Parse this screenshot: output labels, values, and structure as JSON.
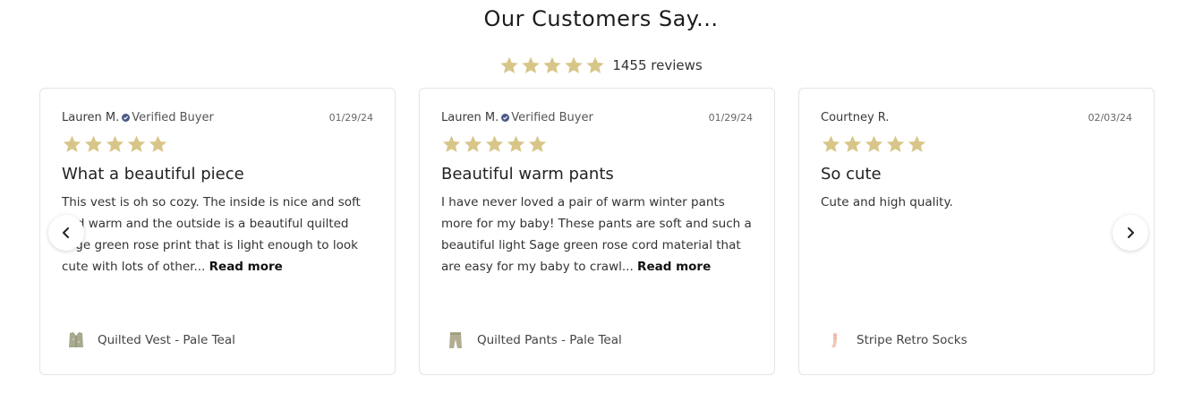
{
  "section_title": "Our Customers Say...",
  "summary": {
    "rating": 5,
    "count_text": "1455 reviews"
  },
  "colors": {
    "star": "#d8c689",
    "verified": "#4a5a87"
  },
  "reviews": [
    {
      "author": "Lauren M.",
      "verified": "Verified Buyer",
      "date": "01/29/24",
      "rating": 5,
      "title": "What a beautiful piece",
      "body": "This vest is oh so cozy. The inside is nice and soft and warm and the outside is a beautiful quilted sage green rose print that is light enough to look cute with lots of other...",
      "read_more": "Read more",
      "product": "Quilted Vest - Pale Teal",
      "product_icon": "vest-thumbnail-icon"
    },
    {
      "author": "Lauren M.",
      "verified": "Verified Buyer",
      "date": "01/29/24",
      "rating": 5,
      "title": "Beautiful warm pants",
      "body": "I have never loved a pair of warm winter pants more for my baby! These pants are soft and such a beautiful light Sage green rose cord material that are easy for my baby to crawl...",
      "read_more": "Read more",
      "product": "Quilted Pants - Pale Teal",
      "product_icon": "pants-thumbnail-icon"
    },
    {
      "author": "Courtney R.",
      "verified": "",
      "date": "02/03/24",
      "rating": 5,
      "title": "So cute",
      "body": "Cute and high quality.",
      "read_more": "",
      "product": "Stripe Retro Socks",
      "product_icon": "socks-thumbnail-icon"
    }
  ],
  "nav": {
    "prev_icon": "chevron-left-icon",
    "next_icon": "chevron-right-icon"
  }
}
